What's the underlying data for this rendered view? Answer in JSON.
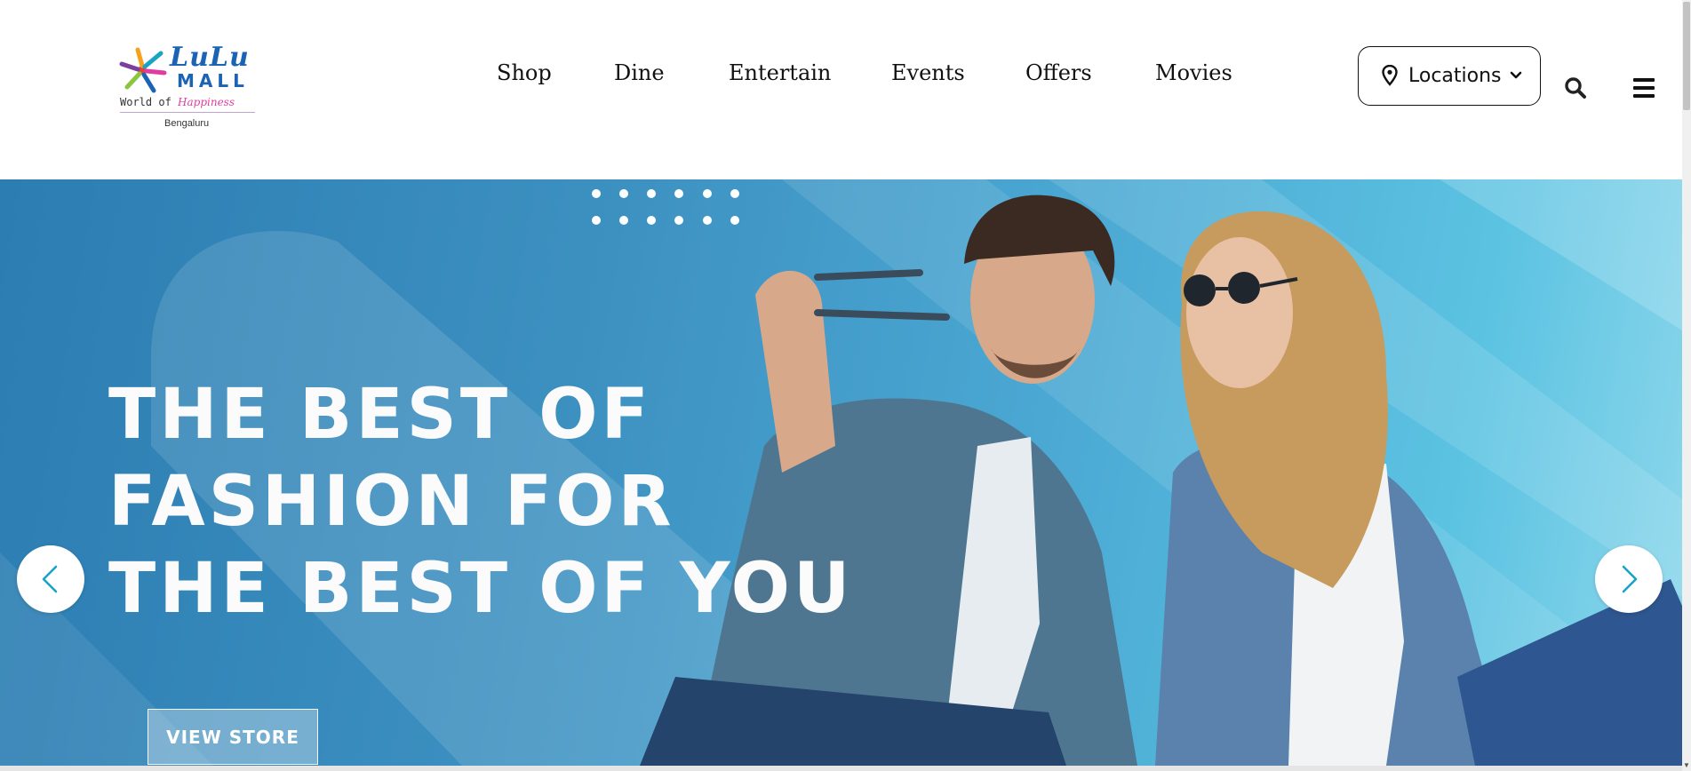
{
  "brand": {
    "name_line1": "LuLu",
    "name_line2": "MALL",
    "tagline_prefix": "World of",
    "tagline_script": "Happiness",
    "city": "Bengaluru"
  },
  "nav": {
    "items": [
      {
        "label": "Shop"
      },
      {
        "label": "Dine"
      },
      {
        "label": "Entertain"
      },
      {
        "label": "Events"
      },
      {
        "label": "Offers"
      },
      {
        "label": "Movies"
      }
    ]
  },
  "header_actions": {
    "locations_label": "Locations",
    "icons": [
      "map-pin-icon",
      "chevron-down-icon",
      "search-icon",
      "hamburger-menu-icon"
    ]
  },
  "hero": {
    "headline_lines": [
      "THE BEST OF",
      "FASHION FOR",
      "THE BEST OF YOU"
    ],
    "cta_label": "VIEW STORE",
    "icons": [
      "chevron-left-icon",
      "chevron-right-icon"
    ]
  },
  "colors": {
    "brand_blue": "#1a63b5",
    "hero_gradient_start": "#2c7db2",
    "hero_gradient_end": "#8fd8ec",
    "arrow_color": "#1aa3c4",
    "text_dark": "#111111"
  }
}
